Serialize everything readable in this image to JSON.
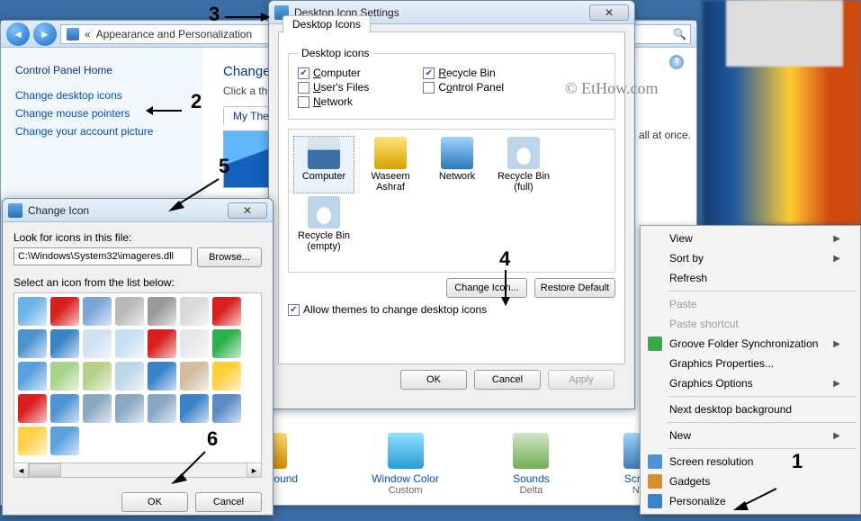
{
  "cp": {
    "breadcrumb_prefix": "«",
    "breadcrumb": "Appearance and Personalization",
    "side_header": "Control Panel Home",
    "links": {
      "desktop_icons": "Change desktop icons",
      "mouse": "Change mouse pointers",
      "account_pic": "Change your account picture"
    },
    "main_heading": "Change t",
    "main_sub": "Click a them",
    "theme_tab": "My Theme",
    "wall_text": "all at once.",
    "bottom": [
      {
        "label": "Background",
        "sub": ""
      },
      {
        "label": "Window Color",
        "sub": "Custom"
      },
      {
        "label": "Sounds",
        "sub": "Delta"
      },
      {
        "label": "Screen",
        "sub": "Non"
      }
    ]
  },
  "dis": {
    "title": "Desktop Icon Settings",
    "tab": "Desktop Icons",
    "group": "Desktop icons",
    "checks": {
      "computer": {
        "label": "Computer",
        "checked": true,
        "accel": "C"
      },
      "users": {
        "label": "User's Files",
        "checked": false,
        "accel": "U"
      },
      "network": {
        "label": "Network",
        "checked": false,
        "accel": "N"
      },
      "recycle": {
        "label": "Recycle Bin",
        "checked": true,
        "accel": "R"
      },
      "cp": {
        "label": "Control Panel",
        "checked": false,
        "accel": "o"
      }
    },
    "preview": [
      {
        "label": "Computer",
        "cls": "pv-comp",
        "sel": true
      },
      {
        "label": "Waseem Ashraf",
        "cls": "pv-user"
      },
      {
        "label": "Network",
        "cls": "pv-net"
      },
      {
        "label": "Recycle Bin (full)",
        "cls": "pv-rb"
      },
      {
        "label": "Recycle Bin (empty)",
        "cls": "pv-rb"
      }
    ],
    "change_icon": "Change Icon...",
    "restore": "Restore Default",
    "allow": "Allow themes to change desktop icons",
    "ok": "OK",
    "cancel": "Cancel",
    "apply": "Apply"
  },
  "ci": {
    "title": "Change Icon",
    "look": "Look for icons in this file:",
    "path": "C:\\Windows\\System32\\imageres.dll",
    "browse": "Browse...",
    "select": "Select an icon from the list below:",
    "ok": "OK",
    "cancel": "Cancel",
    "icons": [
      "#6db3e8",
      "#d91e1e",
      "#7aa6d6",
      "#b8b8b8",
      "#9a9a9a",
      "#d9d9d9",
      "#d91e1e",
      "#4d93d1",
      "#3a83c8",
      "#cfe0f0",
      "#c7dff2",
      "#d91e1e",
      "#e8e8e8",
      "#2bb24b",
      "#5aa0dd",
      "#a7d38b",
      "#b7d088",
      "#bcd5e8",
      "#3a83c8",
      "#d3bda0",
      "#ffcf3a",
      "#d91e1e",
      "#4d93d1",
      "#8aa8c2",
      "#8aa8c2",
      "#8aa8c2",
      "#3a83c8",
      "#5a8bc4",
      "#ffd24a",
      "#5aa0dd"
    ]
  },
  "ctx": {
    "items": [
      {
        "label": "View",
        "arrow": true
      },
      {
        "label": "Sort by",
        "arrow": true
      },
      {
        "label": "Refresh"
      },
      {
        "sep": true
      },
      {
        "label": "Paste",
        "dis": true
      },
      {
        "label": "Paste shortcut",
        "dis": true
      },
      {
        "label": "Groove Folder Synchronization",
        "arrow": true,
        "ico": "#39a84a"
      },
      {
        "label": "Graphics Properties..."
      },
      {
        "label": "Graphics Options",
        "arrow": true
      },
      {
        "sep": true
      },
      {
        "label": "Next desktop background"
      },
      {
        "sep": true
      },
      {
        "label": "New",
        "arrow": true
      },
      {
        "sep": true
      },
      {
        "label": "Screen resolution",
        "ico": "#4d93d1"
      },
      {
        "label": "Gadgets",
        "ico": "#d98c2a"
      },
      {
        "label": "Personalize",
        "ico": "#3a83c8"
      }
    ]
  },
  "anno": {
    "n1": "1",
    "n2": "2",
    "n3": "3",
    "n4": "4",
    "n5": "5",
    "n6": "6"
  },
  "watermark": "© EtHow.com"
}
